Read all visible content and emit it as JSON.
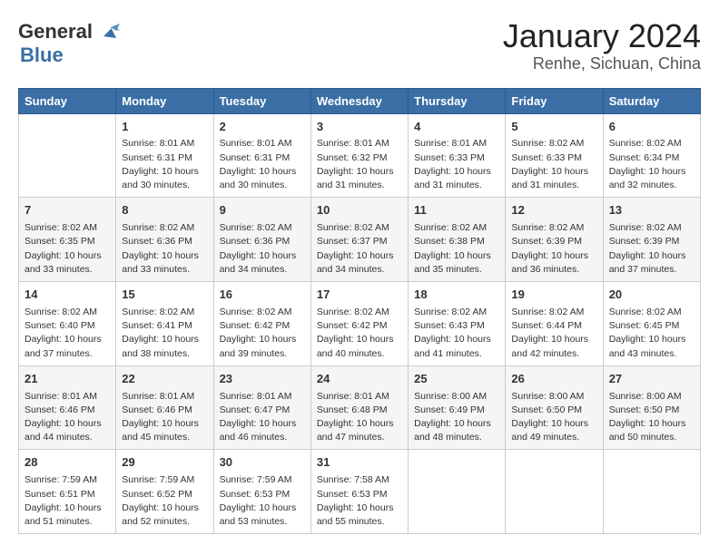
{
  "logo": {
    "general": "General",
    "blue": "Blue"
  },
  "header": {
    "month": "January 2024",
    "location": "Renhe, Sichuan, China"
  },
  "weekdays": [
    "Sunday",
    "Monday",
    "Tuesday",
    "Wednesday",
    "Thursday",
    "Friday",
    "Saturday"
  ],
  "weeks": [
    [
      {
        "day": "",
        "sunrise": "",
        "sunset": "",
        "daylight": ""
      },
      {
        "day": "1",
        "sunrise": "Sunrise: 8:01 AM",
        "sunset": "Sunset: 6:31 PM",
        "daylight": "Daylight: 10 hours and 30 minutes."
      },
      {
        "day": "2",
        "sunrise": "Sunrise: 8:01 AM",
        "sunset": "Sunset: 6:31 PM",
        "daylight": "Daylight: 10 hours and 30 minutes."
      },
      {
        "day": "3",
        "sunrise": "Sunrise: 8:01 AM",
        "sunset": "Sunset: 6:32 PM",
        "daylight": "Daylight: 10 hours and 31 minutes."
      },
      {
        "day": "4",
        "sunrise": "Sunrise: 8:01 AM",
        "sunset": "Sunset: 6:33 PM",
        "daylight": "Daylight: 10 hours and 31 minutes."
      },
      {
        "day": "5",
        "sunrise": "Sunrise: 8:02 AM",
        "sunset": "Sunset: 6:33 PM",
        "daylight": "Daylight: 10 hours and 31 minutes."
      },
      {
        "day": "6",
        "sunrise": "Sunrise: 8:02 AM",
        "sunset": "Sunset: 6:34 PM",
        "daylight": "Daylight: 10 hours and 32 minutes."
      }
    ],
    [
      {
        "day": "7",
        "sunrise": "Sunrise: 8:02 AM",
        "sunset": "Sunset: 6:35 PM",
        "daylight": "Daylight: 10 hours and 33 minutes."
      },
      {
        "day": "8",
        "sunrise": "Sunrise: 8:02 AM",
        "sunset": "Sunset: 6:36 PM",
        "daylight": "Daylight: 10 hours and 33 minutes."
      },
      {
        "day": "9",
        "sunrise": "Sunrise: 8:02 AM",
        "sunset": "Sunset: 6:36 PM",
        "daylight": "Daylight: 10 hours and 34 minutes."
      },
      {
        "day": "10",
        "sunrise": "Sunrise: 8:02 AM",
        "sunset": "Sunset: 6:37 PM",
        "daylight": "Daylight: 10 hours and 34 minutes."
      },
      {
        "day": "11",
        "sunrise": "Sunrise: 8:02 AM",
        "sunset": "Sunset: 6:38 PM",
        "daylight": "Daylight: 10 hours and 35 minutes."
      },
      {
        "day": "12",
        "sunrise": "Sunrise: 8:02 AM",
        "sunset": "Sunset: 6:39 PM",
        "daylight": "Daylight: 10 hours and 36 minutes."
      },
      {
        "day": "13",
        "sunrise": "Sunrise: 8:02 AM",
        "sunset": "Sunset: 6:39 PM",
        "daylight": "Daylight: 10 hours and 37 minutes."
      }
    ],
    [
      {
        "day": "14",
        "sunrise": "Sunrise: 8:02 AM",
        "sunset": "Sunset: 6:40 PM",
        "daylight": "Daylight: 10 hours and 37 minutes."
      },
      {
        "day": "15",
        "sunrise": "Sunrise: 8:02 AM",
        "sunset": "Sunset: 6:41 PM",
        "daylight": "Daylight: 10 hours and 38 minutes."
      },
      {
        "day": "16",
        "sunrise": "Sunrise: 8:02 AM",
        "sunset": "Sunset: 6:42 PM",
        "daylight": "Daylight: 10 hours and 39 minutes."
      },
      {
        "day": "17",
        "sunrise": "Sunrise: 8:02 AM",
        "sunset": "Sunset: 6:42 PM",
        "daylight": "Daylight: 10 hours and 40 minutes."
      },
      {
        "day": "18",
        "sunrise": "Sunrise: 8:02 AM",
        "sunset": "Sunset: 6:43 PM",
        "daylight": "Daylight: 10 hours and 41 minutes."
      },
      {
        "day": "19",
        "sunrise": "Sunrise: 8:02 AM",
        "sunset": "Sunset: 6:44 PM",
        "daylight": "Daylight: 10 hours and 42 minutes."
      },
      {
        "day": "20",
        "sunrise": "Sunrise: 8:02 AM",
        "sunset": "Sunset: 6:45 PM",
        "daylight": "Daylight: 10 hours and 43 minutes."
      }
    ],
    [
      {
        "day": "21",
        "sunrise": "Sunrise: 8:01 AM",
        "sunset": "Sunset: 6:46 PM",
        "daylight": "Daylight: 10 hours and 44 minutes."
      },
      {
        "day": "22",
        "sunrise": "Sunrise: 8:01 AM",
        "sunset": "Sunset: 6:46 PM",
        "daylight": "Daylight: 10 hours and 45 minutes."
      },
      {
        "day": "23",
        "sunrise": "Sunrise: 8:01 AM",
        "sunset": "Sunset: 6:47 PM",
        "daylight": "Daylight: 10 hours and 46 minutes."
      },
      {
        "day": "24",
        "sunrise": "Sunrise: 8:01 AM",
        "sunset": "Sunset: 6:48 PM",
        "daylight": "Daylight: 10 hours and 47 minutes."
      },
      {
        "day": "25",
        "sunrise": "Sunrise: 8:00 AM",
        "sunset": "Sunset: 6:49 PM",
        "daylight": "Daylight: 10 hours and 48 minutes."
      },
      {
        "day": "26",
        "sunrise": "Sunrise: 8:00 AM",
        "sunset": "Sunset: 6:50 PM",
        "daylight": "Daylight: 10 hours and 49 minutes."
      },
      {
        "day": "27",
        "sunrise": "Sunrise: 8:00 AM",
        "sunset": "Sunset: 6:50 PM",
        "daylight": "Daylight: 10 hours and 50 minutes."
      }
    ],
    [
      {
        "day": "28",
        "sunrise": "Sunrise: 7:59 AM",
        "sunset": "Sunset: 6:51 PM",
        "daylight": "Daylight: 10 hours and 51 minutes."
      },
      {
        "day": "29",
        "sunrise": "Sunrise: 7:59 AM",
        "sunset": "Sunset: 6:52 PM",
        "daylight": "Daylight: 10 hours and 52 minutes."
      },
      {
        "day": "30",
        "sunrise": "Sunrise: 7:59 AM",
        "sunset": "Sunset: 6:53 PM",
        "daylight": "Daylight: 10 hours and 53 minutes."
      },
      {
        "day": "31",
        "sunrise": "Sunrise: 7:58 AM",
        "sunset": "Sunset: 6:53 PM",
        "daylight": "Daylight: 10 hours and 55 minutes."
      },
      {
        "day": "",
        "sunrise": "",
        "sunset": "",
        "daylight": ""
      },
      {
        "day": "",
        "sunrise": "",
        "sunset": "",
        "daylight": ""
      },
      {
        "day": "",
        "sunrise": "",
        "sunset": "",
        "daylight": ""
      }
    ]
  ]
}
